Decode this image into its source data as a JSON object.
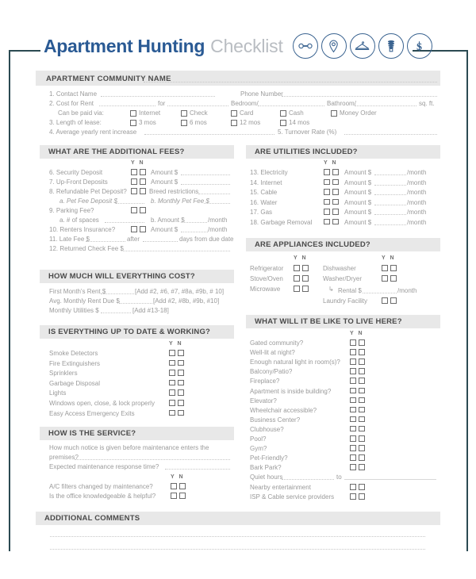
{
  "header": {
    "title_bold": "Apartment Hunting",
    "title_light": "Checklist",
    "icons": [
      "key-icon",
      "location-pin-icon",
      "clothes-hanger-icon",
      "light-bulb-icon",
      "dollar-sign-icon"
    ]
  },
  "community": {
    "label": "APARTMENT COMMUNITY NAME"
  },
  "top_fields": {
    "contact_name": "1. Contact Name",
    "phone_number": "Phone Number",
    "cost_for_rent": "2. Cost for Rent",
    "for": "for",
    "bedroom": "Bedroom/",
    "bathroom": "Bathroom/",
    "sqft": "sq. ft.",
    "paid_via": "Can be paid via:",
    "payment_options": [
      "Internet",
      "Check",
      "Card",
      "Cash",
      "Money Order"
    ],
    "length_of_lease": "3. Length of lease:",
    "lease_options": [
      "3 mos",
      "6 mos",
      "12 mos",
      "14 mos"
    ],
    "rent_increase": "4. Average yearly rent increase",
    "turnover_rate": "5. Turnover Rate (%)"
  },
  "fees": {
    "heading": "WHAT ARE THE ADDITIONAL FEES?",
    "yn": "Y  N",
    "rows": [
      {
        "label": "6. Security Deposit",
        "suffix": "Amount $"
      },
      {
        "label": "7. Up-Front Deposits",
        "suffix": "Amount $"
      },
      {
        "label": "8. Refundable Pet Deposit?",
        "suffix": "Breed restrictions"
      }
    ],
    "pet_a": "a. Pet Fee Deposit $",
    "pet_b": "b. Monthly Pet Fee $",
    "parking": "9. Parking Fee?",
    "parking_a": "a. # of spaces",
    "parking_b": "b. Amount $",
    "parking_b_unit": "/month",
    "renters": "10. Renters Insurance?",
    "renters_suffix": "Amount $",
    "renters_unit": "/month",
    "late_fee": "11. Late Fee $",
    "late_fee_after": "after",
    "late_fee_days": "days from due date",
    "returned_check": "12. Returned Check Fee $"
  },
  "utilities": {
    "heading": "ARE UTILITIES INCLUDED?",
    "yn": "Y  N",
    "amount_label": "Amount $",
    "unit": "/month",
    "rows": [
      "13. Electricity",
      "14. Internet",
      "15. Cable",
      "16. Water",
      "17. Gas",
      "18. Garbage Removal"
    ]
  },
  "appliances": {
    "heading": "ARE APPLIANCES INCLUDED?",
    "yn": "Y  N",
    "left_rows": [
      "Refrigerator",
      "Stove/Oven",
      "Microwave"
    ],
    "right_rows": [
      "Dishwasher",
      "Washer/Dryer"
    ],
    "rental_label": "Rental $",
    "rental_unit": "/month",
    "laundry": "Laundry Facility"
  },
  "cost": {
    "heading": "HOW MUCH WILL EVERYTHING COST?",
    "rows": [
      {
        "label": "First Month's Rent $",
        "note": "[Add #2, #6, #7, #8a, #9b, # 10]"
      },
      {
        "label": "Avg. Monthly Rent Due $",
        "note": "[Add #2, #8b, #9b, #10]"
      },
      {
        "label": "Monthly Utilities $",
        "note": "[Add #13-18]"
      }
    ]
  },
  "working": {
    "heading": "IS EVERYTHING UP TO DATE & WORKING?",
    "yn": "Y  N",
    "rows": [
      "Smoke Detectors",
      "Fire Extinguishers",
      "Sprinklers",
      "Garbage Disposal",
      "Lights",
      "Windows open, close, & lock properly",
      "Easy Access Emergency Exits"
    ]
  },
  "service": {
    "heading": "HOW IS THE SERVICE?",
    "notice_line1": "How much notice is given before maintenance enters the",
    "notice_line2": "premises?",
    "response_time": "Expected maintenance response time?",
    "yn": "Y  N",
    "rows": [
      "A/C filters changed by maintenance?",
      "Is the office knowledgeable & helpful?"
    ]
  },
  "live_here": {
    "heading": "WHAT WILL IT BE LIKE TO LIVE HERE?",
    "yn": "Y  N",
    "rows": [
      "Gated community?",
      "Well-lit at night?",
      "Enough natural light in room(s)?",
      "Balcony/Patio?",
      "Fireplace?",
      "Apartment is inside building?",
      "Elevator?",
      "Wheelchair accessible?",
      "Business Center?",
      "Clubhouse?",
      "Pool?",
      "Gym?",
      "Pet-Friendly?",
      "Bark Park?"
    ],
    "quiet_hours": "Quiet hours",
    "quiet_to": "to",
    "tail_rows": [
      "Nearby entertainment",
      "ISP & Cable service providers"
    ]
  },
  "comments": {
    "heading": "ADDITIONAL COMMENTS"
  },
  "colors": {
    "title_blue": "#2a5a94",
    "title_gray": "#b9bdc2",
    "bar_gray": "#e8e8e8",
    "frame_navy": "#2b4a52"
  }
}
